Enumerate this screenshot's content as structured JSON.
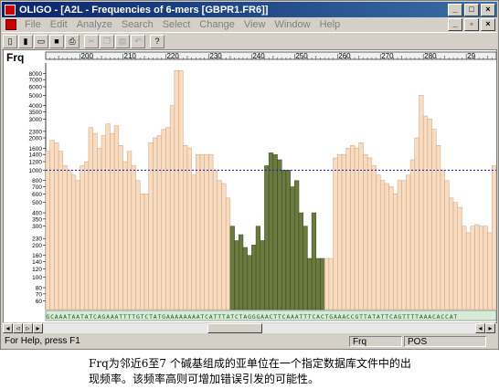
{
  "window": {
    "title": "OLIGO - [A2L - Frequencies of 6-mers [GBPR1.FR6]]"
  },
  "menu": [
    "File",
    "Edit",
    "Analyze",
    "Search",
    "Select",
    "Change",
    "View",
    "Window",
    "Help"
  ],
  "menu_enabled": [
    false,
    false,
    false,
    false,
    false,
    false,
    false,
    false,
    false
  ],
  "plot": {
    "label": "Frq"
  },
  "chart_data": {
    "type": "bar",
    "title": "",
    "ylabel": "Frq",
    "yscale": "log",
    "ylim": [
      50,
      10000
    ],
    "yticks": [
      60,
      70,
      80,
      100,
      120,
      140,
      160,
      200,
      230,
      300,
      350,
      400,
      500,
      600,
      700,
      800,
      1000,
      1200,
      1400,
      1600,
      2000,
      2300,
      3000,
      3500,
      4000,
      5000,
      6000,
      7000,
      8000
    ],
    "threshold": 1000,
    "x_ticks": [
      200,
      210,
      220,
      230,
      240,
      250,
      260,
      270,
      280,
      290
    ],
    "x_tick_labels": [
      "200",
      "210",
      "220",
      "230",
      "240",
      "250",
      "260",
      "270",
      "280",
      "29"
    ],
    "x_start": 192,
    "values": [
      1500,
      1900,
      1800,
      1500,
      1100,
      1000,
      900,
      800,
      1100,
      1200,
      2500,
      2200,
      1600,
      2100,
      2700,
      2200,
      2600,
      1700,
      1200,
      1500,
      1100,
      800,
      600,
      600,
      1800,
      2000,
      2100,
      2400,
      2500,
      4000,
      8500,
      8500,
      1700,
      1600,
      900,
      1400,
      1400,
      1400,
      1400,
      1000,
      800,
      750,
      550,
      300,
      220,
      250,
      190,
      160,
      200,
      300,
      220,
      1100,
      1450,
      1400,
      1250,
      1000,
      1000,
      700,
      800,
      400,
      300,
      150,
      400,
      150,
      150,
      150,
      150,
      1300,
      1400,
      1400,
      1600,
      1700,
      1600,
      1800,
      1400,
      1300,
      1100,
      900,
      800,
      750,
      700,
      600,
      800,
      800,
      900,
      1250,
      2000,
      5000,
      3200,
      3000,
      2400,
      1700,
      1000,
      800,
      550,
      500,
      450,
      300,
      260,
      300,
      310,
      300,
      300,
      260,
      1100
    ],
    "series": [
      {
        "name": "",
        "color": "#f9dcbf",
        "range": [
          0,
          43
        ]
      },
      {
        "name": "",
        "color": "#6b7a3e",
        "range": [
          43,
          65
        ]
      },
      {
        "name": "",
        "color": "#f9dcbf",
        "range": [
          65,
          106
        ]
      }
    ],
    "highlight_bars": [
      43,
      44,
      45,
      46,
      47,
      48,
      49,
      50,
      51,
      52,
      53,
      54,
      55,
      56,
      57,
      58,
      59,
      60,
      61,
      62,
      63,
      64
    ],
    "sequence": "GCAAATAATATCAGAAATTTTGTCTATGAAAAAAAATCATTTATCTAGGGAACTTCAAATTTCACTGAAACCGTTATATTCAGTTTTAAACACCAT",
    "colors": {
      "bar_fill": "#f9dcbf",
      "bar_stroke": "#c9a080",
      "highlight_fill": "#6b7a3e",
      "highlight_stroke": "#3a4520",
      "threshold": "#1a1ab5",
      "sequence_bg": "#d8ead8",
      "sequence_fg": "#1a5a2a"
    }
  },
  "status": {
    "help": "For Help, press F1",
    "frq": "Frq",
    "pos": "POS"
  },
  "caption": {
    "line1": "Frq为邻近6至7 个碱基组成的亚单位在一个指定数据库文件中的出",
    "line2": "现频率。该频率高则可增加错误引发的可能性。"
  }
}
